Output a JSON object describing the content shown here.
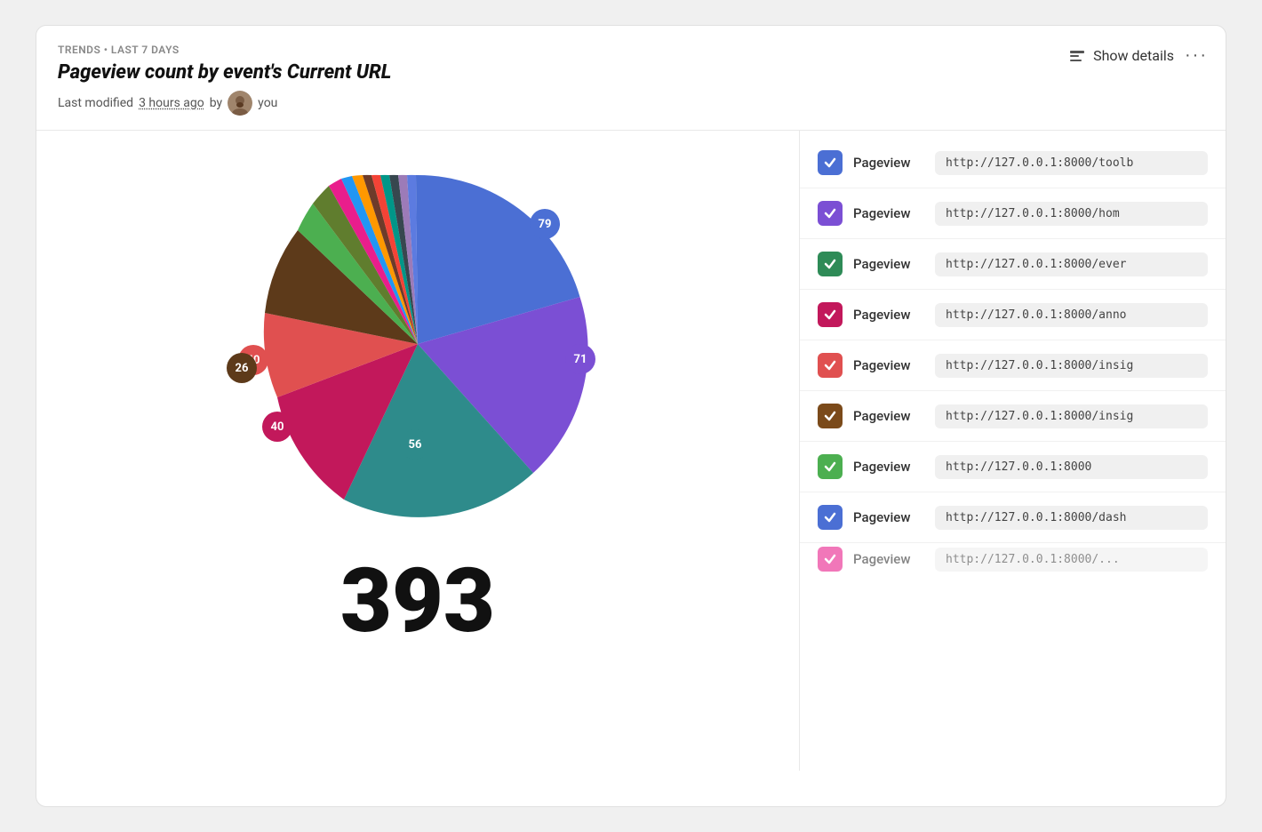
{
  "header": {
    "trends_label": "TRENDS • LAST 7 DAYS",
    "title": "Pageview count by event's Current URL",
    "modified_text": "Last modified",
    "modified_time": "3 hours ago",
    "modified_by": "by",
    "modified_user": "you",
    "show_details_label": "Show details",
    "more_label": "···"
  },
  "chart": {
    "total": "393",
    "labels": [
      {
        "value": "79",
        "color": "#4B4BF0"
      },
      {
        "value": "71",
        "color": "#7B5EA7"
      },
      {
        "value": "56",
        "color": "#2E8B8B"
      },
      {
        "value": "40",
        "color": "#E05050"
      },
      {
        "value": "40",
        "color": "#C2185B"
      },
      {
        "value": "26",
        "color": "#5D3A1A"
      }
    ]
  },
  "legend": {
    "items": [
      {
        "color": "#4B6FD4",
        "event": "Pageview",
        "url": "http://127.0.0.1:8000/toolb"
      },
      {
        "color": "#7B4FD4",
        "event": "Pageview",
        "url": "http://127.0.0.1:8000/hom"
      },
      {
        "color": "#2E8B57",
        "event": "Pageview",
        "url": "http://127.0.0.1:8000/ever"
      },
      {
        "color": "#C2185B",
        "event": "Pageview",
        "url": "http://127.0.0.1:8000/anno"
      },
      {
        "color": "#E05050",
        "event": "Pageview",
        "url": "http://127.0.0.1:8000/insig"
      },
      {
        "color": "#7B4A1A",
        "event": "Pageview",
        "url": "http://127.0.0.1:8000/insig"
      },
      {
        "color": "#4CAF50",
        "event": "Pageview",
        "url": "http://127.0.0.1:8000"
      },
      {
        "color": "#4B6FD4",
        "event": "Pageview",
        "url": "http://127.0.0.1:8000/dash"
      },
      {
        "color": "#E91E8C",
        "event": "Pageview",
        "url": "http://127.0.0.1:8000/..."
      }
    ]
  }
}
